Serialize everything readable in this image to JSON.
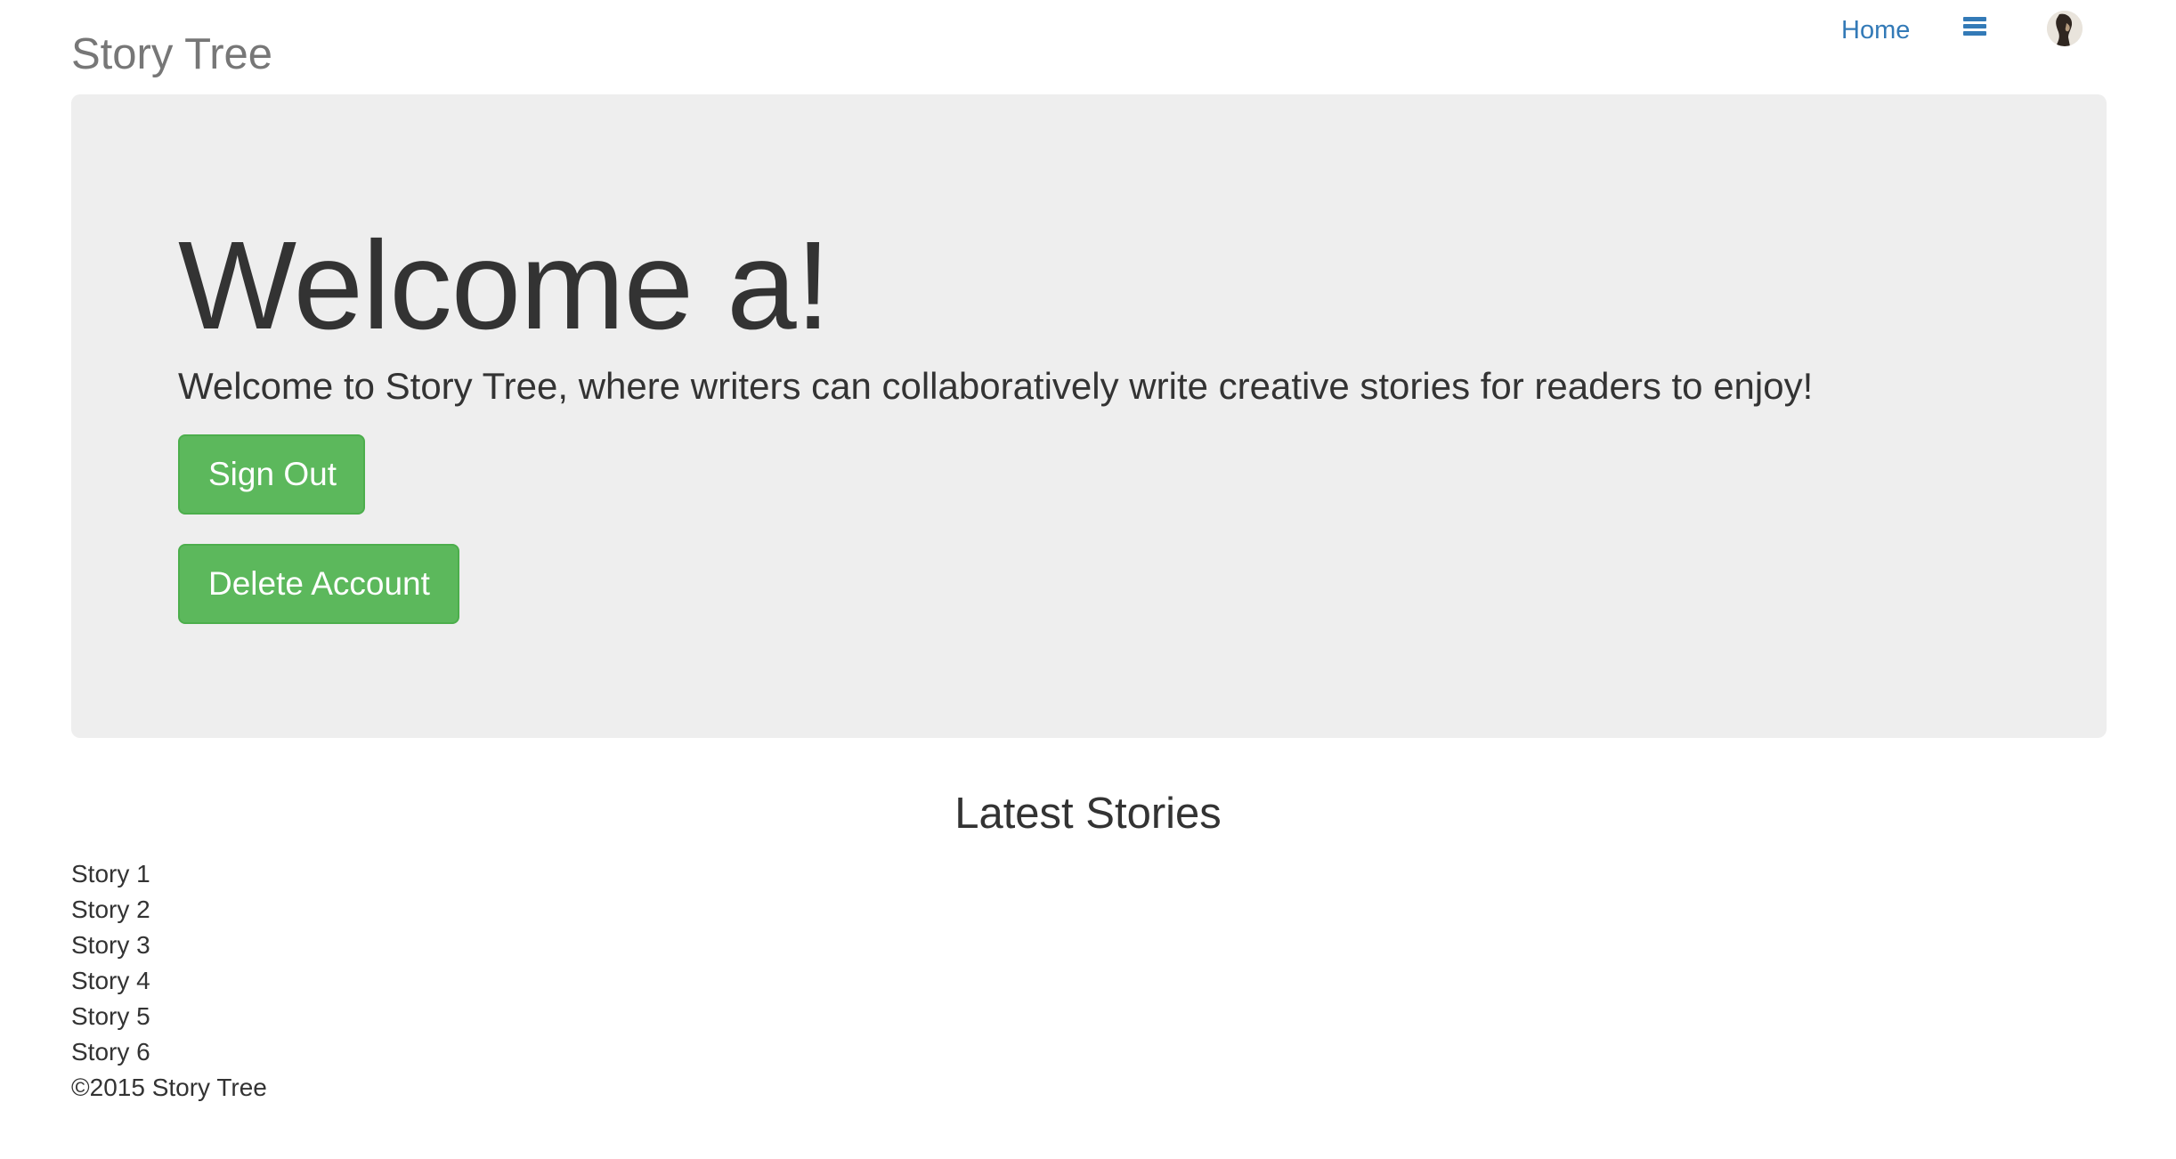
{
  "header": {
    "brand": "Story Tree",
    "nav": {
      "home_label": "Home",
      "menu_icon": "hamburger-menu-icon",
      "avatar_icon": "user-avatar"
    }
  },
  "hero": {
    "title": "Welcome a!",
    "lead": "Welcome to Story Tree, where writers can collaboratively write creative stories for readers to enjoy!",
    "buttons": {
      "sign_out": "Sign Out",
      "delete_account": "Delete Account"
    }
  },
  "latest": {
    "title": "Latest Stories",
    "stories": [
      "Story 1",
      "Story 2",
      "Story 3",
      "Story 4",
      "Story 5",
      "Story 6"
    ]
  },
  "footer": {
    "text": "©2015 Story Tree"
  },
  "colors": {
    "brand_text": "#777777",
    "link": "#337ab7",
    "jumbotron_bg": "#eeeeee",
    "button_bg": "#5cb85c",
    "button_border": "#4cae4c"
  }
}
